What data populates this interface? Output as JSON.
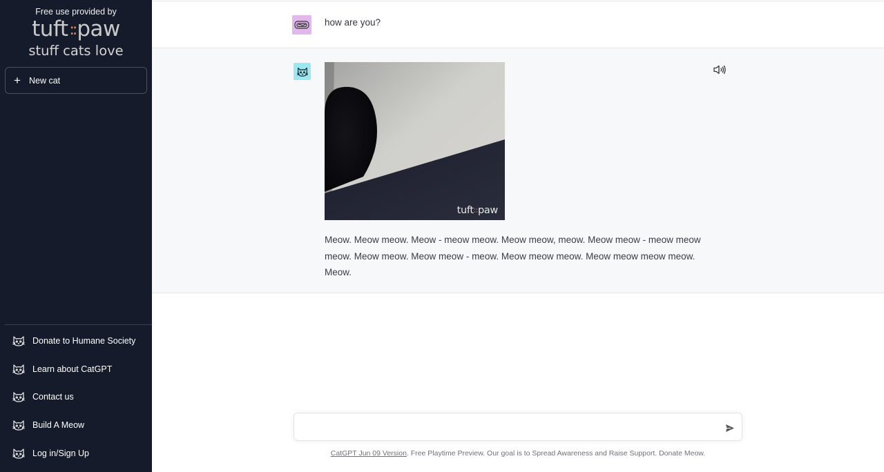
{
  "sidebar": {
    "sponsor_caption": "Free use provided by",
    "brand_left": "tuft",
    "brand_dots": "::",
    "brand_right": "paw",
    "tagline": "stuff cats love",
    "new_button": {
      "icon": "plus-icon",
      "label": "New cat"
    },
    "links": [
      {
        "icon": "cat-face-icon",
        "label": "Donate to Humane Society"
      },
      {
        "icon": "cat-face-icon",
        "label": "Learn about CatGPT"
      },
      {
        "icon": "cat-face-icon",
        "label": "Contact us"
      },
      {
        "icon": "cat-face-icon",
        "label": "Build A Meow"
      },
      {
        "icon": "cat-face-icon",
        "label": "Log in/Sign Up"
      }
    ]
  },
  "conversation": {
    "user_message": {
      "avatar": "cat-bed-icon",
      "text": "how are you?"
    },
    "bot_message": {
      "avatar": "cat-face-icon",
      "action_icon": "speaker-icon",
      "image_watermark_left": "tuft",
      "image_watermark_dots": "::",
      "image_watermark_right": "paw",
      "text": "Meow. Meow meow. Meow - meow meow. Meow meow, meow. Meow meow - meow meow meow. Meow meow. Meow meow - meow. Meow meow meow. Meow meow meow meow. Meow."
    }
  },
  "composer": {
    "value": "",
    "placeholder": "",
    "send_icon": "send-icon"
  },
  "footer": {
    "version_link": "CatGPT Jun 09 Version",
    "text": ". Free Playtime Preview. Our goal is to Spread Awareness and Raise Support. Donate Meow."
  },
  "colors": {
    "sidebar_bg": "#151b2b",
    "user_avatar_bg": "#e2b8ec",
    "bot_avatar_bg": "#9de7f2",
    "bot_row_bg": "#f7f8fa",
    "brand_accent": "#e8905f"
  }
}
